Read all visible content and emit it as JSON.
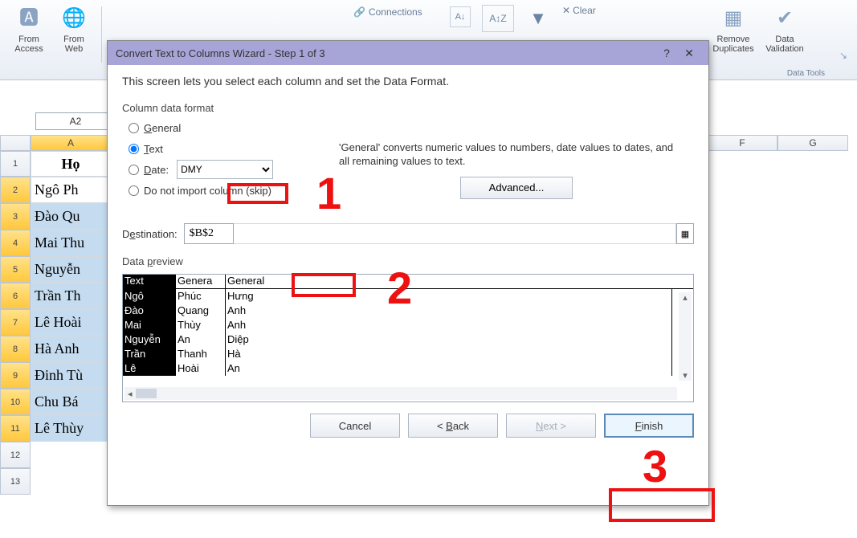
{
  "ribbon": {
    "from_access": "From\nAccess",
    "from_web": "From\nWeb",
    "connections": "Connections",
    "clear": "Clear",
    "remove_dup": "Remove\nDuplicates",
    "data_val": "Data\nValidation",
    "group_label": "Data Tools"
  },
  "cellref": "A2",
  "sheet": {
    "col_header": "Họ",
    "rows": [
      "Ngô Ph",
      "Đào Qu",
      "Mai Thu",
      "Nguyễn",
      "Trần Th",
      "Lê Hoài",
      "Hà Anh",
      "Đinh Tù",
      "Chu Bá",
      "Lê Thùy"
    ],
    "colF": "F",
    "colG": "G"
  },
  "dialog": {
    "title": "Convert Text to Columns Wizard - Step 1 of 3",
    "intro": "This screen lets you select each column and set the Data Format.",
    "group_label": "Column data format",
    "opt_general": "General",
    "opt_text": "Text",
    "opt_date": "Date:",
    "date_fmt": "DMY",
    "opt_skip": "Do not import column (skip)",
    "desc": "'General' converts numeric values to numbers, date values to dates, and all remaining values to text.",
    "advanced": "Advanced...",
    "dest_label": "Destination:",
    "dest_value": "$B$2",
    "preview_label": "Data preview",
    "preview_head": [
      "Text",
      "Genera",
      "General"
    ],
    "preview_rows": [
      [
        "Ngô",
        "Phúc",
        "Hưng"
      ],
      [
        "Đào",
        "Quang",
        "Anh"
      ],
      [
        "Mai",
        "Thùy",
        "Anh"
      ],
      [
        "Nguyễn",
        "An",
        "Diệp"
      ],
      [
        "Trần",
        "Thanh",
        "Hà"
      ],
      [
        "Lê",
        "Hoài",
        "An"
      ]
    ],
    "btn_cancel": "Cancel",
    "btn_back": "< Back",
    "btn_next": "Next >",
    "btn_finish": "Finish"
  },
  "annotations": {
    "n1": "1",
    "n2": "2",
    "n3": "3"
  },
  "chart_data": null
}
